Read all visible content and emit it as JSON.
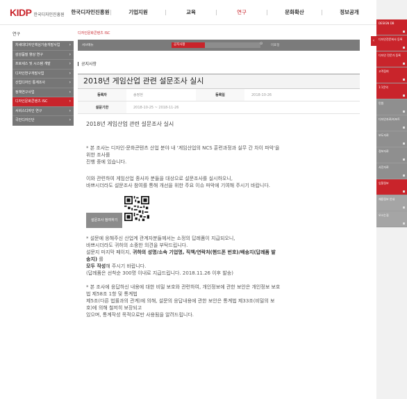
{
  "header": {
    "logo_mark": "KIDP",
    "logo_text": "한국디자인진흥원",
    "nav": [
      "한국디자인진흥원",
      "기업지원",
      "교육",
      "연구",
      "문화확산",
      "정보공개"
    ],
    "active_nav": "연구"
  },
  "sidebar": {
    "title": "연구",
    "items": [
      {
        "label": "차세대디자인핵심기술개발사업",
        "active": false
      },
      {
        "label": "감성품질 향상 연구",
        "active": false
      },
      {
        "label": "프로세스 및 시스템 개발",
        "active": false
      },
      {
        "label": "디자인연구개발사업",
        "active": false
      },
      {
        "label": "산업디자인 통계조사",
        "active": false
      },
      {
        "label": "정책연구사업",
        "active": false
      },
      {
        "label": "디자인문화콘텐츠 ISC",
        "active": true
      },
      {
        "label": "서비스디자인 연구",
        "active": false
      },
      {
        "label": "국민디자인단",
        "active": false
      }
    ]
  },
  "main": {
    "breadcrumb": "디자인문화콘텐츠 ISC",
    "search": {
      "label": "서브메뉴",
      "select_value": "공지사항",
      "input_value": "",
      "button": "⊙",
      "extra": "미표정"
    },
    "page_title": "공지사항",
    "post": {
      "title": "2018년 게임산업 관련 설문조사 실시",
      "author_label": "등록자",
      "author": "송정현",
      "date_label": "등록일",
      "date": "2018-10-26",
      "period_label": "설문기한",
      "period": "2018-10-25 ~ 2018-11-26"
    },
    "content": {
      "headline": "2018년 게임산업 관련 설문조사 실시",
      "p1a": "* 본 조사는 디자인·문화콘텐츠 산업 분야 내 '게임산업의 NCS 훈련과정과 실무 간 차이 파악'을",
      "p1b": "위한 조사를",
      "p1c": "  진행 중에 있습니다.",
      "p2a": "이와 관련하여 게임산업 종사자 분들을 대상으로 설문조사를 실시하오니,",
      "p2b": "바쁘시더라도 설문조사 참여를 통해 개선을 위한 주요 이슈 파악에 기여해 주시기 바랍니다.",
      "survey_button": "설문조사 참여하기",
      "p3a": "* 설문에 응해주신 산업계 관계자분들께서는 소정의 답례품이 지급되오니,",
      "p3b": "  바쁘시더라도 귀하의 소중한 의견을 부탁드립니다.",
      "p3c_pre": "  설문지 마지막 페이지, ",
      "p3c_bold": "귀하의 성명/소속 기업명, 직책/연락처(핸드폰 번호)/배송지(답례품 발",
      "p3d_bold": "송지)",
      "p3d_rest": " 를",
      "p3e_bold": "  모두 작성",
      "p3e_rest": "해 주시기 바랍니다.",
      "p3f": "  (답례품은 선착순 300명 이내로 지급드립니다. 2018.11.26 이후 발송)",
      "p4a": "* 본 조사에 응답하신 내용에 대한 비밀 보호와 관련하여, 개인정보에 관한 보안은 개인정보 보호",
      "p4b": "법 제58조 1항 및 통계법",
      "p4c": "  제5조(다른 법률과의 관계)에 의해, 설문의 응답내용에 관한 보안은 통계법 제33조(비밀의 보",
      "p4d": "호)에 의해 철저히 보장되고",
      "p4e": "  있으며, 통계작성 목적으로만 사용됨을 알려드립니다."
    }
  },
  "quick_menu": {
    "handle": "‹",
    "items": [
      {
        "label": "DESIGN DB",
        "style": "red"
      },
      {
        "label": "디자인전문회사 등록",
        "style": "red"
      },
      {
        "label": "디자인 전문가 등록",
        "style": "red"
      },
      {
        "label": "고객참여",
        "style": "red"
      },
      {
        "label": "1:1문의",
        "style": "red"
      },
      {
        "label": "민원",
        "style": "dark"
      },
      {
        "label": "디자인자료/리포트",
        "style": "dark"
      },
      {
        "label": "보도자료",
        "style": "dark"
      },
      {
        "label": "정보자료",
        "style": "dark"
      },
      {
        "label": "사진자료",
        "style": "dark"
      },
      {
        "label": "입찰정보",
        "style": "red"
      },
      {
        "label": "채용정보 안내",
        "style": "gray"
      },
      {
        "label": "오시는길",
        "style": "gray"
      }
    ]
  },
  "colors": {
    "brand": "#c9242b",
    "sidebar": "#767676",
    "searchbar": "#7b7b7b"
  }
}
